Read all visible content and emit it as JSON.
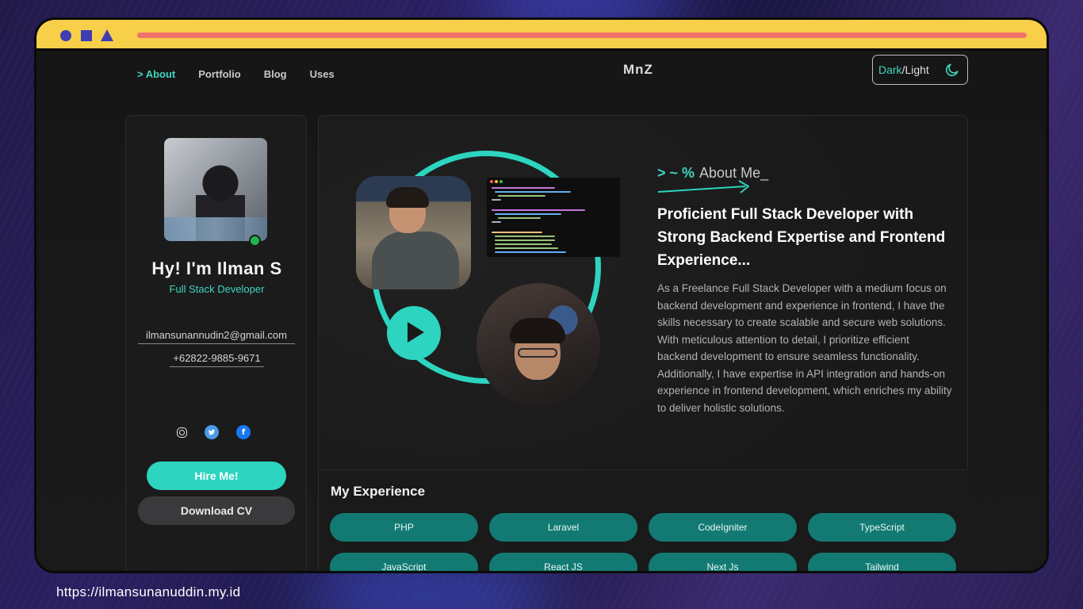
{
  "nav": {
    "items": [
      {
        "label": "> About",
        "active": true
      },
      {
        "label": "Portfolio",
        "active": false
      },
      {
        "label": "Blog",
        "active": false
      },
      {
        "label": "Uses",
        "active": false
      }
    ],
    "logo": "MnZ",
    "theme_toggle": {
      "dark": "Dark",
      "separator": "/",
      "light": "Light",
      "icon": "moon-icon"
    }
  },
  "profile": {
    "name": "Hy! I'm Ilman S",
    "role": "Full Stack Developer",
    "email": "ilmansunannudin2@gmail.com",
    "phone": "+62822-9885-9671",
    "socials": [
      "instagram-icon",
      "twitter-icon",
      "facebook-icon"
    ],
    "hire_label": "Hire Me!",
    "cv_label": "Download CV"
  },
  "about": {
    "prompt": "> ~ %",
    "title": "About Me_",
    "headline": "Proficient Full Stack Developer with Strong Backend Expertise and Frontend Experience...",
    "description": "As a Freelance Full Stack Developer with a medium focus on backend development and experience in frontend, I have the skills necessary to create scalable and secure web solutions. With meticulous attention to detail, I prioritize efficient backend development to ensure seamless functionality. Additionally, I have expertise in API integration and hands-on experience in frontend development, which enriches my ability to deliver holistic solutions."
  },
  "experience": {
    "title": "My Experience",
    "skills": [
      "PHP",
      "Laravel",
      "CodeIgniter",
      "TypeScript",
      "JavaScript",
      "React JS",
      "Next Js",
      "Tailwind"
    ]
  },
  "footer": {
    "url": "https://ilmansunanuddin.my.id"
  },
  "colors": {
    "accent": "#2dd4bf",
    "titlebar": "#f8cf48",
    "titlebar_bar": "#f0736a",
    "chip": "#127a72"
  }
}
